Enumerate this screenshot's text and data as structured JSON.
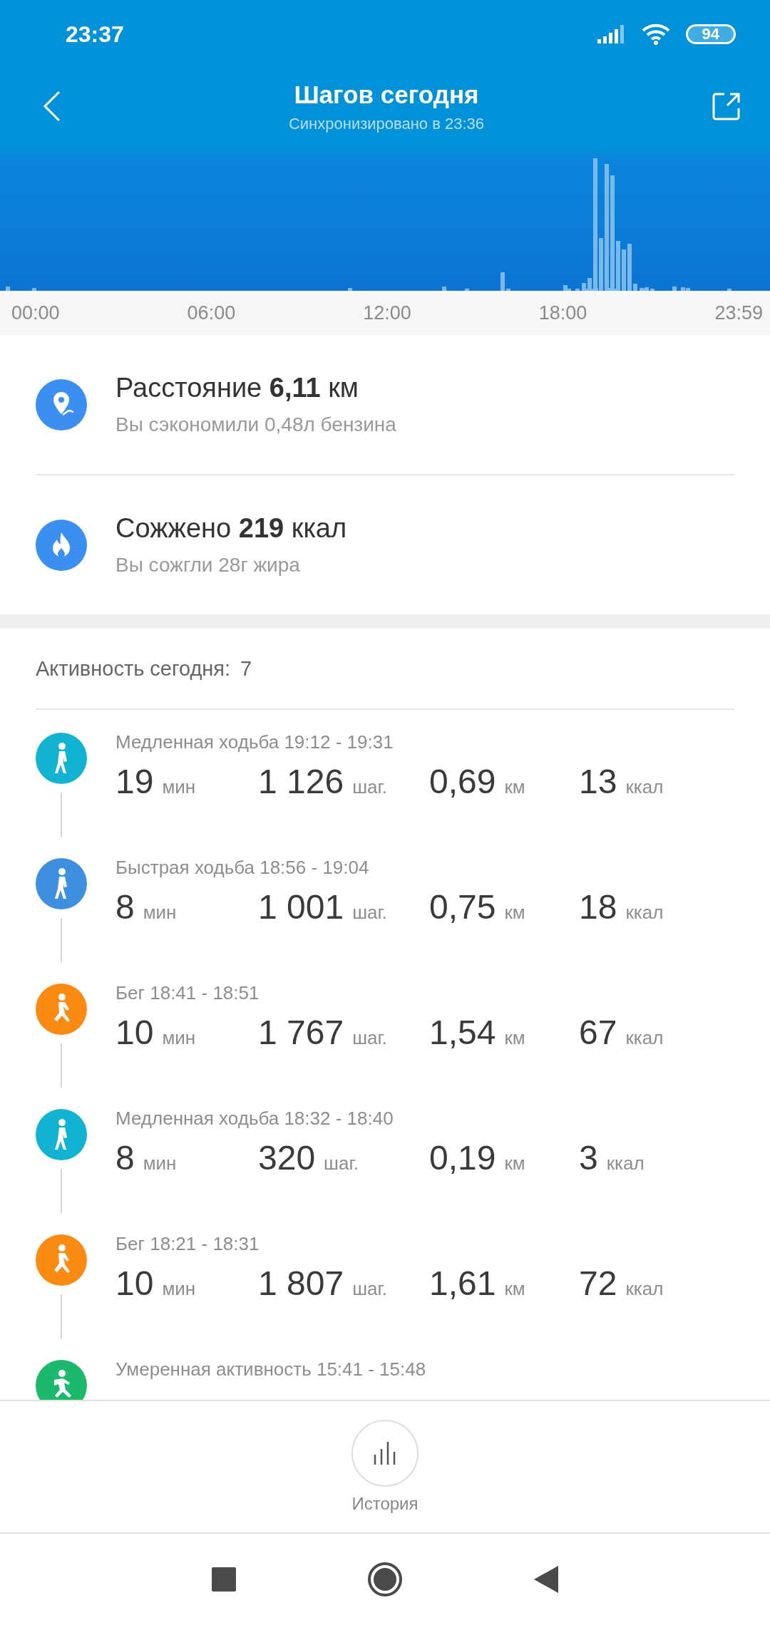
{
  "status_bar": {
    "time": "23:37",
    "battery": "94"
  },
  "header": {
    "title": "Шагов сегодня",
    "subtitle": "Синхронизировано в 23:36"
  },
  "chart": {
    "axis_labels": [
      "00:00",
      "06:00",
      "12:00",
      "18:00",
      "23:59"
    ]
  },
  "summary": [
    {
      "kind": "distance",
      "title": "Расстояние **6,11** км",
      "subtitle": "Вы сэкономили 0,48л бензина"
    },
    {
      "kind": "calories",
      "title": "Сожжено **219** ккал",
      "subtitle": "Вы сожгли 28г жира"
    }
  ],
  "activity": {
    "heading": "Активность сегодня:",
    "count": "7",
    "items": [
      {
        "kind": "walk",
        "color": "#12b3d0",
        "title": "Медленная ходьба 19:12 - 19:31",
        "values": [
          {
            "value": "19",
            "unit": "мин"
          },
          {
            "value": "1 126",
            "unit": "шаг."
          },
          {
            "value": "0,69",
            "unit": "км"
          },
          {
            "value": "13",
            "unit": "ккал"
          }
        ]
      },
      {
        "kind": "walk",
        "color": "#3f8fe0",
        "title": "Быстрая ходьба 18:56 - 19:04",
        "values": [
          {
            "value": "8",
            "unit": "мин"
          },
          {
            "value": "1 001",
            "unit": "шаг."
          },
          {
            "value": "0,75",
            "unit": "км"
          },
          {
            "value": "18",
            "unit": "ккал"
          }
        ]
      },
      {
        "kind": "run",
        "color": "#fa8a12",
        "title": "Бег 18:41 - 18:51",
        "values": [
          {
            "value": "10",
            "unit": "мин"
          },
          {
            "value": "1 767",
            "unit": "шаг."
          },
          {
            "value": "1,54",
            "unit": "км"
          },
          {
            "value": "67",
            "unit": "ккал"
          }
        ]
      },
      {
        "kind": "walk",
        "color": "#12b3d0",
        "title": "Медленная ходьба 18:32 - 18:40",
        "values": [
          {
            "value": "8",
            "unit": "мин"
          },
          {
            "value": "320",
            "unit": "шаг."
          },
          {
            "value": "0,19",
            "unit": "км"
          },
          {
            "value": "3",
            "unit": "ккал"
          }
        ]
      },
      {
        "kind": "run",
        "color": "#fa8a12",
        "title": "Бег 18:21 - 18:31",
        "values": [
          {
            "value": "10",
            "unit": "мин"
          },
          {
            "value": "1 807",
            "unit": "шаг."
          },
          {
            "value": "1,61",
            "unit": "км"
          },
          {
            "value": "72",
            "unit": "ккал"
          }
        ]
      },
      {
        "kind": "moderate",
        "color": "#1cb86b",
        "title": "Умеренная активность 15:41 - 15:48"
      }
    ]
  },
  "bottom": {
    "history_label": "История"
  }
}
